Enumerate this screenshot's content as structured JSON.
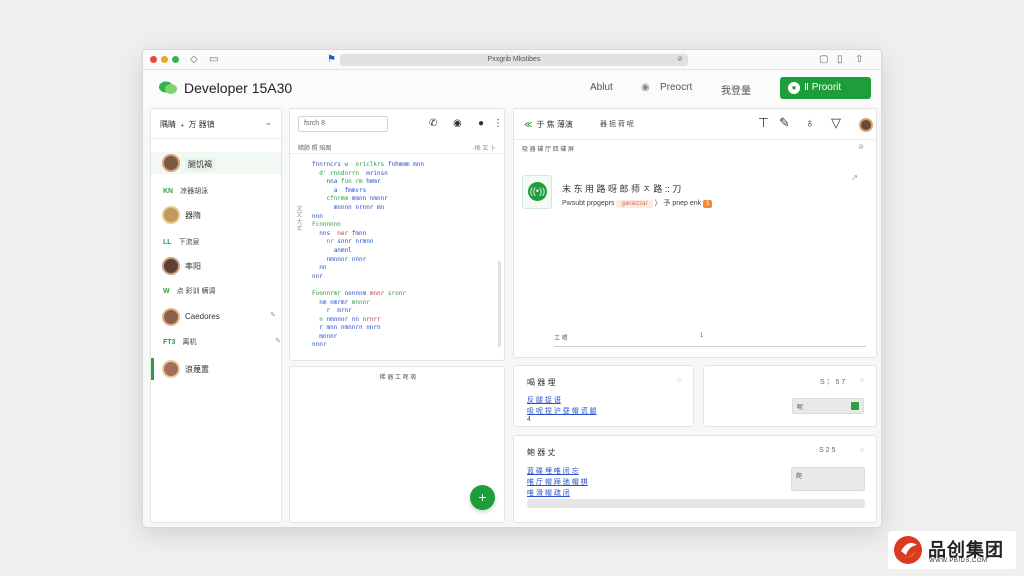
{
  "browser": {
    "address": "Pxxgrib Mkstibes",
    "icons": [
      "back-icon",
      "window-icon",
      "flag-icon",
      "lock-icon",
      "square-icon",
      "copy-icon",
      "share-icon"
    ]
  },
  "header": {
    "title": "Developer 15A30",
    "nav": [
      "Ablut",
      "Preocrt",
      "我登量"
    ],
    "primary_button": "Ⅱ Proorit"
  },
  "sidebar": {
    "heading": "隅睛 ﹢ 万 器镇",
    "items": [
      {
        "label": "腿饥褐",
        "avatar_color": "#7b5a45"
      },
      {
        "label": "凉器胡泳",
        "code": "KN"
      },
      {
        "label": "器隋",
        "avatar_color": "#c09a5a"
      },
      {
        "label": "下流泉",
        "code": "LL"
      },
      {
        "label": "率阳",
        "avatar_color": "#5e4036"
      },
      {
        "label": "点 彩训 螨调",
        "code": "W"
      },
      {
        "label": "Caedores",
        "avatar_color": "#8a6048"
      },
      {
        "label": "离机",
        "code": "FT3"
      },
      {
        "label": "浪蔑置",
        "avatar_color": "#a0705a"
      }
    ]
  },
  "editor": {
    "search_placeholder": "fsrch 8",
    "tabs": "暗肺  照  陪图",
    "tabs_right": "-侯 又 卜",
    "gutter": "文丈 大丈",
    "code_lines": [
      [
        {
          "c": "k",
          "t": "fnnrncrs "
        },
        {
          "c": "s",
          "t": "w  oriclkrs "
        },
        {
          "c": "k",
          "t": "fnhmmm mnn"
        }
      ],
      [
        {
          "c": "c",
          "t": "  "
        },
        {
          "c": "s",
          "t": "d' rnndnrrn  "
        },
        {
          "c": "k",
          "t": "mrinsn"
        }
      ],
      [
        {
          "c": "c",
          "t": "    "
        },
        {
          "c": "k",
          "t": "nna "
        },
        {
          "c": "s",
          "t": "fun rm "
        },
        {
          "c": "k",
          "t": "hmmr"
        }
      ],
      [
        {
          "c": "c",
          "t": "      "
        },
        {
          "c": "k",
          "t": "a  fmmvrs"
        }
      ],
      [
        {
          "c": "c",
          "t": "    "
        },
        {
          "c": "s",
          "t": "cfnrmm "
        },
        {
          "c": "k",
          "t": "mmnn nmnnr"
        }
      ],
      [
        {
          "c": "c",
          "t": "      "
        },
        {
          "c": "k",
          "t": "mnnnn nrnnr mn"
        }
      ],
      [
        {
          "c": "k",
          "t": "nnn"
        }
      ],
      [
        {
          "c": "s",
          "t": "Fcnnnnnn"
        }
      ],
      [
        {
          "c": "c",
          "t": "  "
        },
        {
          "c": "k",
          "t": "nns  "
        },
        {
          "c": "t",
          "t": "ner "
        },
        {
          "c": "k",
          "t": "fmnn"
        }
      ],
      [
        {
          "c": "c",
          "t": "    "
        },
        {
          "c": "s",
          "t": "nr "
        },
        {
          "c": "k",
          "t": "snnr nrmnn"
        }
      ],
      [
        {
          "c": "c",
          "t": "      "
        },
        {
          "c": "k",
          "t": "anmnl"
        }
      ],
      [
        {
          "c": "c",
          "t": "    "
        },
        {
          "c": "k",
          "t": "nmnnnr nnnr"
        }
      ],
      [
        {
          "c": "c",
          "t": "  "
        },
        {
          "c": "k",
          "t": "nn"
        }
      ],
      [
        {
          "c": "k",
          "t": "nnr"
        }
      ],
      [
        {
          "c": "c",
          "t": ""
        }
      ],
      [
        {
          "c": "s",
          "t": "Foonnrmr "
        },
        {
          "c": "k",
          "t": "nonnnm "
        },
        {
          "c": "t",
          "t": "mnnr "
        },
        {
          "c": "s",
          "t": "sronr"
        }
      ],
      [
        {
          "c": "c",
          "t": "  "
        },
        {
          "c": "k",
          "t": "nm nmrmr "
        },
        {
          "c": "s",
          "t": "mnnnr"
        }
      ],
      [
        {
          "c": "c",
          "t": "    "
        },
        {
          "c": "k",
          "t": "r  mrnr"
        }
      ],
      [
        {
          "c": "c",
          "t": "  "
        },
        {
          "c": "s",
          "t": "n "
        },
        {
          "c": "k",
          "t": "nmnnnr nn "
        },
        {
          "c": "t",
          "t": "nrnrr"
        }
      ],
      [
        {
          "c": "c",
          "t": "  "
        },
        {
          "c": "k",
          "t": "r mnn nmnnrn nnrn"
        }
      ],
      [
        {
          "c": "c",
          "t": "  "
        },
        {
          "c": "k",
          "t": "mnnnr"
        }
      ],
      [
        {
          "c": "k",
          "t": "nnnr"
        }
      ]
    ]
  },
  "output": {
    "label": "稀 器 工 呢 吸"
  },
  "detail": {
    "title": "于 焦 薄演",
    "title_code": "≪",
    "subtitle": "器 扼 荷 呢",
    "subheader": "吸 器 碟 厅 回 碟 屏",
    "heading": "末 东 用  路 呀 郎 师 ㅈ 路 :: 刀",
    "meta_prefix": "Pwsubt prpgeprs",
    "meta_pill": "ganiezzar",
    "meta_middle": "〉 予 pnep enk",
    "meta_badge": "1",
    "timeline_left": "工 喂",
    "timeline_right": "1"
  },
  "cards": {
    "a": {
      "title": "喝 器 埋",
      "links": [
        "反 腿 捉 语",
        "吸 呢 捏 沪 昼 帽 谎 腿",
        "4"
      ]
    },
    "b": {
      "number": "S 冫 5 7",
      "bar_label": "呢"
    },
    "c": {
      "title": "鲍 器 丈",
      "number": "S 2 5",
      "links": [
        "蓝 碟 埋 唯 闭 忘",
        "唯 厅 帽 蹄 驰 帽 棋",
        "唯 滑 帽 疏 闭"
      ],
      "bar_label": "爬"
    }
  },
  "watermark": {
    "brand": "品创集团",
    "url": "WWW.PBIDS.COM"
  },
  "colors": {
    "accent": "#1e9e3a",
    "link": "#2a4fcf",
    "pill": "#f08c3a"
  }
}
